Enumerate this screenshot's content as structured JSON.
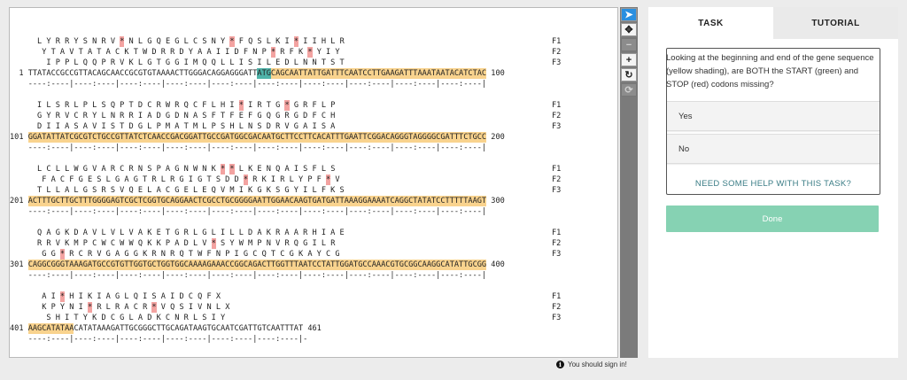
{
  "sequence_viewer": {
    "blocks": [
      {
        "f1": "  L Y R R Y S N R V * N L G Q E G L C S N Y * F Q S L K I * I I H L R",
        "f2": "   Y T A V T A T A C K T W D R R D Y A A I I D F N P * R F K * Y I Y",
        "f3": "    I P P L Q Q P R V K L G T G G I M Q Q L L I S I L E D L N N T S T",
        "start": "1",
        "bases": "TTATACCGCCGTTACAGCAACCGCGTGTAAAACTTGGGACAGGAGGGATTATGCAGCAATTATTGATTTCAATCCTTGAAGATTTAAATAATACATCTAC",
        "end": "100",
        "ruler": "----:----|----:----|----:----|----:----|----:----|----:----|----:----|----:----|----:----|----:----|"
      },
      {
        "f1": "  I L S R L P L S Q P T D C R W R Q C F L H I * I R T G * G R F L P",
        "f2": "  G Y R V C R Y L N R R I A D G D N A S F T F E F G Q G R G D F C H",
        "f3": "  D I I A S A V I S T D G L P M A T M L P S H L N S D R V G A I S A",
        "start": "101",
        "bases": "GGATATTATCGCGTCTGCCGTTATCTCAACCGACGGATTGCCGATGGCGACAATGCTTCCTTCACATTTGAATTCGGACAGGGTAGGGGCGATTTCTGCC",
        "end": "200",
        "ruler": "----:----|----:----|----:----|----:----|----:----|----:----|----:----|----:----|----:----|----:----|"
      },
      {
        "f1": "  L C L L W G V A R C R N S P A G N W N K * * L K E N Q A I S F L S",
        "f2": "   F A C F G E S L G A G T R L R G I G T S D D * R K I R L Y P F * V",
        "f3": "  T L L A L G S R S V Q E L A C G E L E Q V M I K G K S G Y I L F K S",
        "start": "201",
        "bases": "ACTTTGCTTGCTTTGGGGAGTCGCTCGGTGCAGGAACTCGCCTGCGGGGAATTGGAACAAGTGATGATTAAAGGAAAATCAGGCTATATCCTTTTTAAGT",
        "end": "300",
        "ruler": "----:----|----:----|----:----|----:----|----:----|----:----|----:----|----:----|----:----|----:----|"
      },
      {
        "f1": "  Q A G K D A V L V L V A K E T G R L G L I L L D A K R A A R H I A E",
        "f2": "  R R V K M P C W C W W Q K K P A D L V * S Y W M P N V R Q G I L R",
        "f3": "   G G * R C R V G A G G K R N R Q T W F N P I G C Q T C G K A Y C G",
        "start": "301",
        "bases": "CAGGCGGGTAAAGATGCCGTGTTGGTGCTGGTGGCAAAAGAAACCGGCAGACTTGGTTTAATCCTATTGGATGCCAAACGTGCGGCAAGGCATATTGCGG",
        "end": "400",
        "ruler": "----:----|----:----|----:----|----:----|----:----|----:----|----:----|----:----|----:----|----:----|"
      },
      {
        "f1": "   A I * H I K I A G L Q I S A I D C Q F X",
        "f2": "   K P Y N I * R L R A C R * V Q S I V N L X",
        "f3": "    S H I T Y K D C G L A D K C N R L S I Y",
        "start": "401",
        "bases": "AAGCATATAACATATAAAGATTGCGGGCTTGCAGATAAGTGCAATCGATTGTCAATTTAT",
        "end": "461",
        "ruler": "----:----|----:----|----:----|----:----|----:----|----:----|-"
      }
    ],
    "frame_labels": [
      "F1",
      "F2",
      "F3"
    ]
  },
  "toolbar": {
    "tools": [
      "pointer-icon",
      "move-icon",
      "zoom-out-icon",
      "zoom-in-icon",
      "rotate-icon",
      "reset-icon"
    ]
  },
  "status": {
    "signin_text": "You should sign in!"
  },
  "panel": {
    "tabs": [
      {
        "label": "TASK",
        "active": true
      },
      {
        "label": "TUTORIAL",
        "active": false
      }
    ],
    "question": "Looking at the beginning and end of the gene sequence (yellow shading), are BOTH the START (green) and STOP (red) codons missing?",
    "options": [
      "Yes",
      "No"
    ],
    "help_link": "NEED SOME HELP WITH THIS TASK?",
    "done_label": "Done"
  },
  "colors": {
    "gene_shading": "#f9d38e",
    "start_codon": "#4fb3a9",
    "stop_codon": "#f3a3a1",
    "done_button": "#86d2b3",
    "active_tool": "#2a8fe0"
  }
}
